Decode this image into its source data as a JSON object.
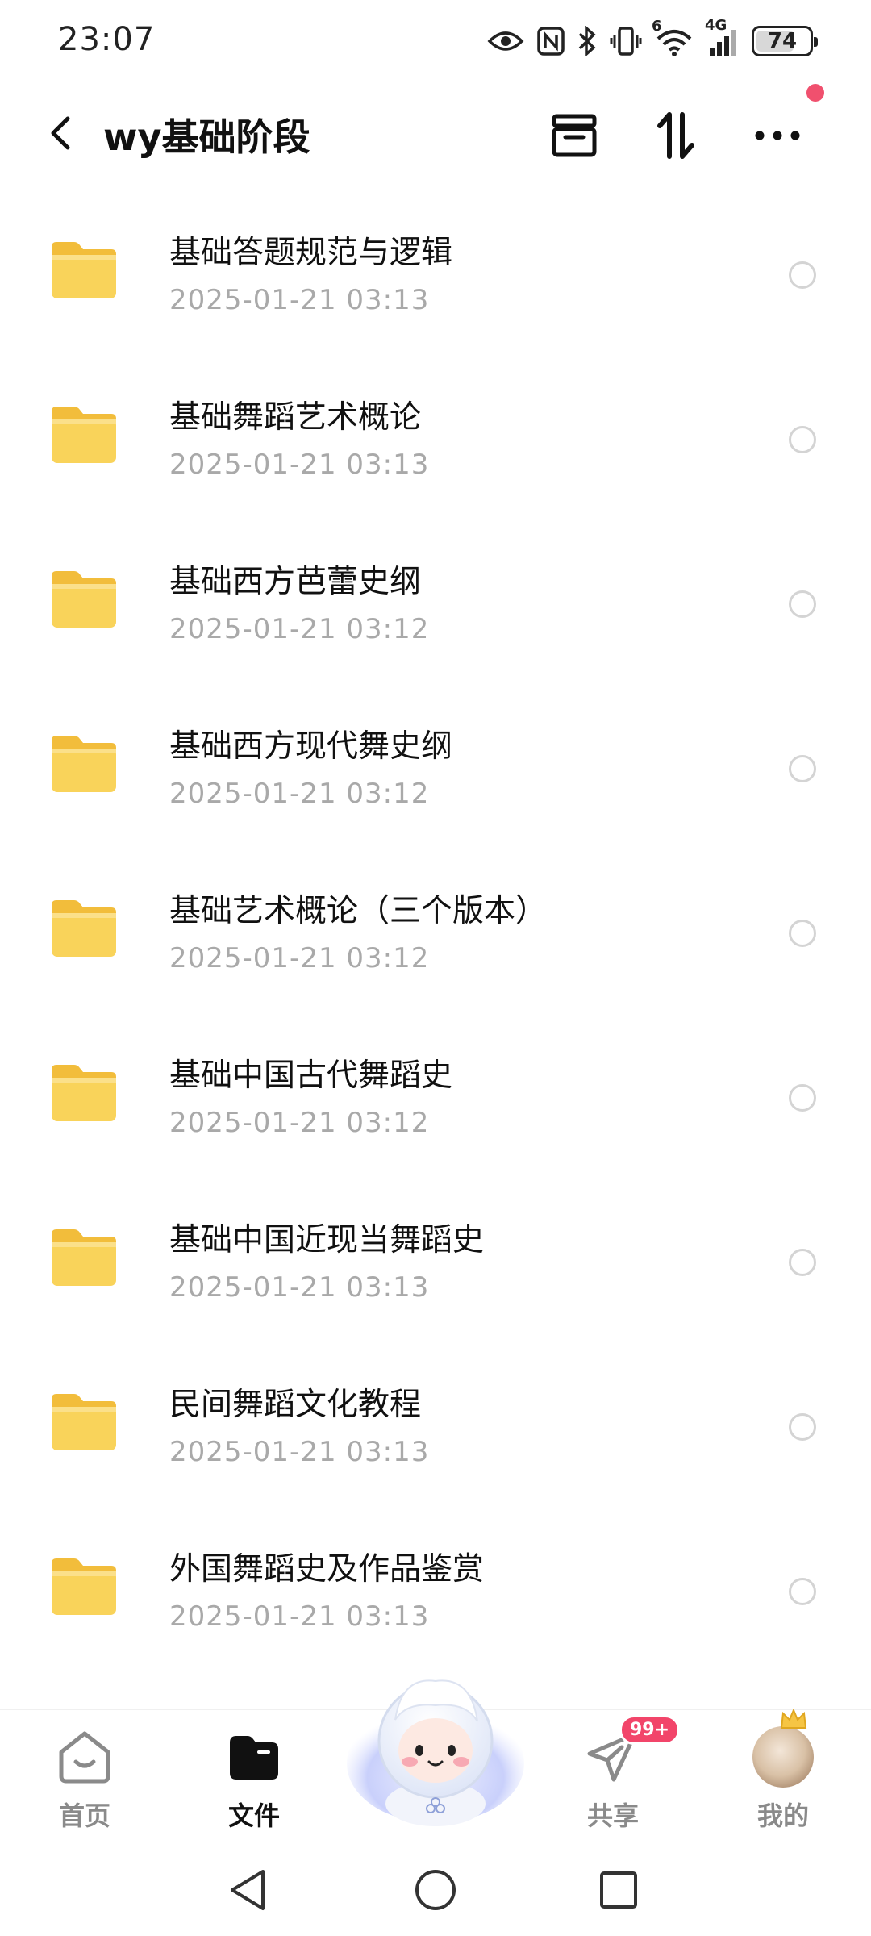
{
  "status_bar": {
    "time": "23:07",
    "icons": [
      "eye-icon",
      "nfc-icon",
      "bluetooth-icon",
      "vibrate-icon",
      "wifi-icon",
      "signal-icon"
    ],
    "wifi_label": "6",
    "network_label": "4G",
    "battery": "74",
    "battery_level": 0.74
  },
  "header": {
    "title": "wy基础阶段",
    "back_icon": "chevron-left-icon",
    "actions": [
      "archive-icon",
      "sort-icon",
      "more-icon"
    ],
    "notification_dot_color": "#f0506e"
  },
  "files": [
    {
      "name": "基础答题规范与逻辑",
      "date": "2025-01-21  03:13"
    },
    {
      "name": "基础舞蹈艺术概论",
      "date": "2025-01-21  03:13"
    },
    {
      "name": "基础西方芭蕾史纲",
      "date": "2025-01-21  03:12"
    },
    {
      "name": "基础西方现代舞史纲",
      "date": "2025-01-21  03:12"
    },
    {
      "name": "基础艺术概论（三个版本）",
      "date": "2025-01-21  03:12"
    },
    {
      "name": "基础中国古代舞蹈史",
      "date": "2025-01-21  03:12"
    },
    {
      "name": "基础中国近现当舞蹈史",
      "date": "2025-01-21  03:13"
    },
    {
      "name": "民间舞蹈文化教程",
      "date": "2025-01-21  03:13"
    },
    {
      "name": "外国舞蹈史及作品鉴赏",
      "date": "2025-01-21  03:13"
    }
  ],
  "bottom_nav": {
    "home": "首页",
    "files": "文件",
    "share": "共享",
    "share_badge": "99+",
    "mine": "我的",
    "active": "files"
  },
  "colors": {
    "folder": "#f9d35a",
    "badge": "#f2456a",
    "date_text": "#a9a9a9"
  }
}
